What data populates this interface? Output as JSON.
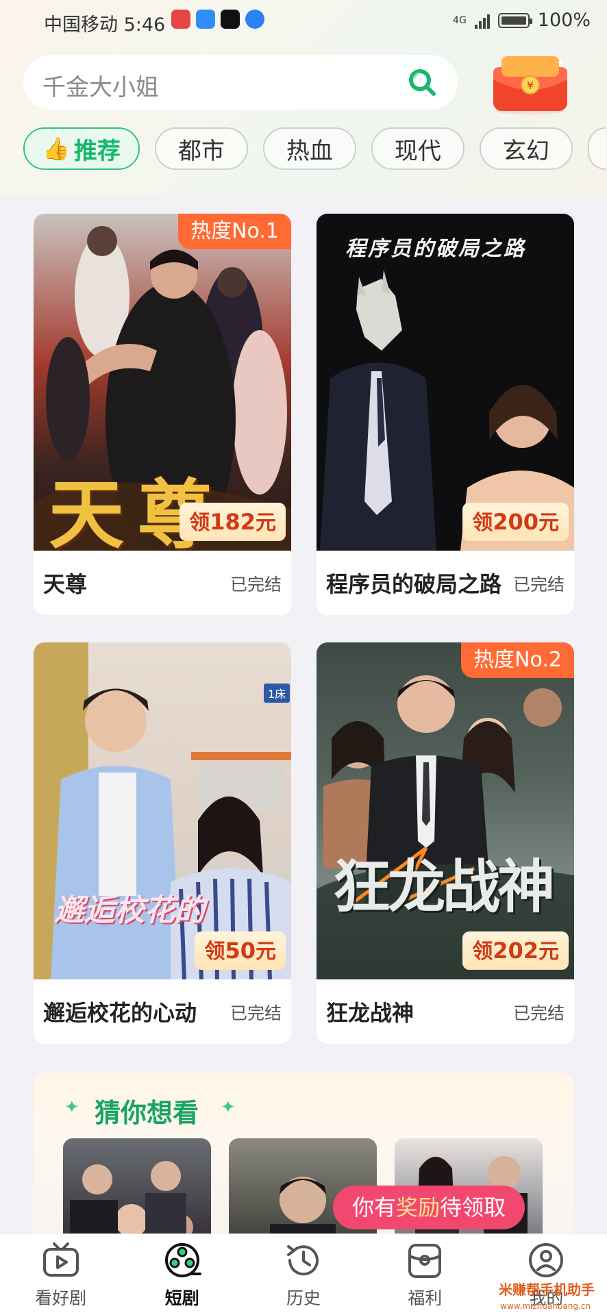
{
  "status_bar": {
    "carrier_time": "中国移动 5:46",
    "network": "4G",
    "battery": "100%"
  },
  "search": {
    "placeholder": "千金大小姐"
  },
  "tabs": [
    {
      "label": "推荐",
      "active": true
    },
    {
      "label": "都市"
    },
    {
      "label": "热血"
    },
    {
      "label": "现代"
    },
    {
      "label": "玄幻"
    }
  ],
  "cards": [
    {
      "title": "天尊",
      "status": "已完结",
      "hot_badge": "热度No.1",
      "reward_prefix": "领",
      "reward_amount": "182",
      "reward_unit": "元",
      "poster_text": "天尊"
    },
    {
      "title": "程序员的破局之路",
      "status": "已完结",
      "hot_badge": "",
      "reward_prefix": "领",
      "reward_amount": "200",
      "reward_unit": "元",
      "poster_text": "程序员的破局之路"
    },
    {
      "title": "邂逅校花的心动",
      "status": "已完结",
      "hot_badge": "",
      "reward_prefix": "领",
      "reward_amount": "50",
      "reward_unit": "元",
      "poster_text": "邂逅校花的",
      "bed_tag": "1床"
    },
    {
      "title": "狂龙战神",
      "status": "已完结",
      "hot_badge": "热度No.2",
      "reward_prefix": "领",
      "reward_amount": "202",
      "reward_unit": "元",
      "poster_text": "狂龙战神"
    }
  ],
  "guess_section": {
    "title": "猜你想看"
  },
  "reward_tip": {
    "prefix": "你有",
    "highlight": "奖励",
    "suffix": "待领取"
  },
  "bottom_nav": [
    {
      "label": "看好剧",
      "icon": "tv-play-icon"
    },
    {
      "label": "短剧",
      "icon": "film-reel-icon",
      "active": true
    },
    {
      "label": "历史",
      "icon": "history-clock-icon"
    },
    {
      "label": "福利",
      "icon": "gift-welfare-icon"
    },
    {
      "label": "我的",
      "icon": "profile-icon"
    }
  ],
  "watermark": {
    "text": "米赚帮手机助手",
    "url_text": "www.mizhuanbang.cn"
  },
  "colors": {
    "accent_green": "#12b86b",
    "hot_orange": "#ff6a35",
    "reward_red": "#d23a14",
    "tip_pink": "#f2486f"
  }
}
